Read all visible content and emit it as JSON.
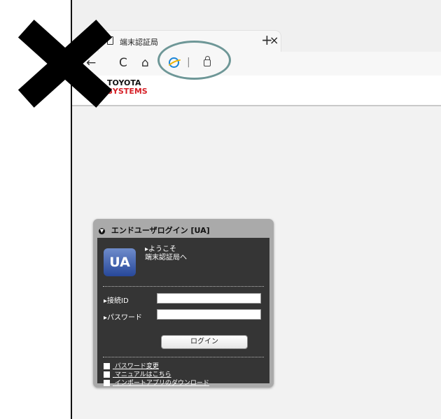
{
  "browser": {
    "tab_title": "端末認証局",
    "close_glyph": "×",
    "new_tab_glyph": "+",
    "refresh_glyph": "C",
    "home_glyph": "⌂",
    "back_glyph": "←",
    "separator": "|"
  },
  "header": {
    "logo_top": "TOYOTA",
    "logo_bottom": "SYSTEMS",
    "logo_colors": {
      "top": "#111111",
      "bottom": "#d61f26"
    }
  },
  "login": {
    "title": "エンドユーザログイン [UA]",
    "brand_badge": "UA",
    "welcome_line1": "▸ようこそ",
    "welcome_line2": "端末認証局へ",
    "id_label": "▸接続ID",
    "password_label": "▸パスワード",
    "id_value": "",
    "password_value": "",
    "button_label": "ログイン",
    "links": [
      "パスワード変更",
      "マニュアルはこちら",
      "インポートアプリのダウンロード"
    ]
  },
  "overlay": {
    "x_mark_icon": "black-x-mark",
    "highlight_color": "#6e9797"
  }
}
